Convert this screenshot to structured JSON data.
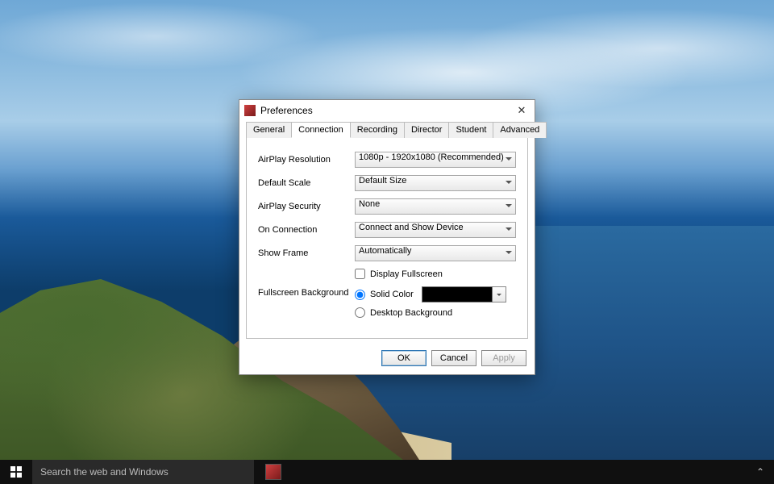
{
  "taskbar": {
    "search_placeholder": "Search the web and Windows",
    "tray_caret": "⌃"
  },
  "dialog": {
    "title": "Preferences",
    "tabs": [
      "General",
      "Connection",
      "Recording",
      "Director",
      "Student",
      "Advanced"
    ],
    "active_tab_index": 1,
    "fields": {
      "airplay_resolution": {
        "label": "AirPlay Resolution",
        "value": "1080p - 1920x1080 (Recommended)"
      },
      "default_scale": {
        "label": "Default Scale",
        "value": "Default Size"
      },
      "airplay_security": {
        "label": "AirPlay Security",
        "value": "None"
      },
      "on_connection": {
        "label": "On Connection",
        "value": "Connect and Show Device"
      },
      "show_frame": {
        "label": "Show Frame",
        "value": "Automatically"
      },
      "display_fullscreen": {
        "label": "Display Fullscreen",
        "checked": false
      },
      "fullscreen_background": {
        "label": "Fullscreen Background",
        "option_solid": "Solid Color",
        "option_desktop": "Desktop Background",
        "selected": "solid",
        "color": "#000000"
      }
    },
    "buttons": {
      "ok": "OK",
      "cancel": "Cancel",
      "apply": "Apply"
    }
  }
}
